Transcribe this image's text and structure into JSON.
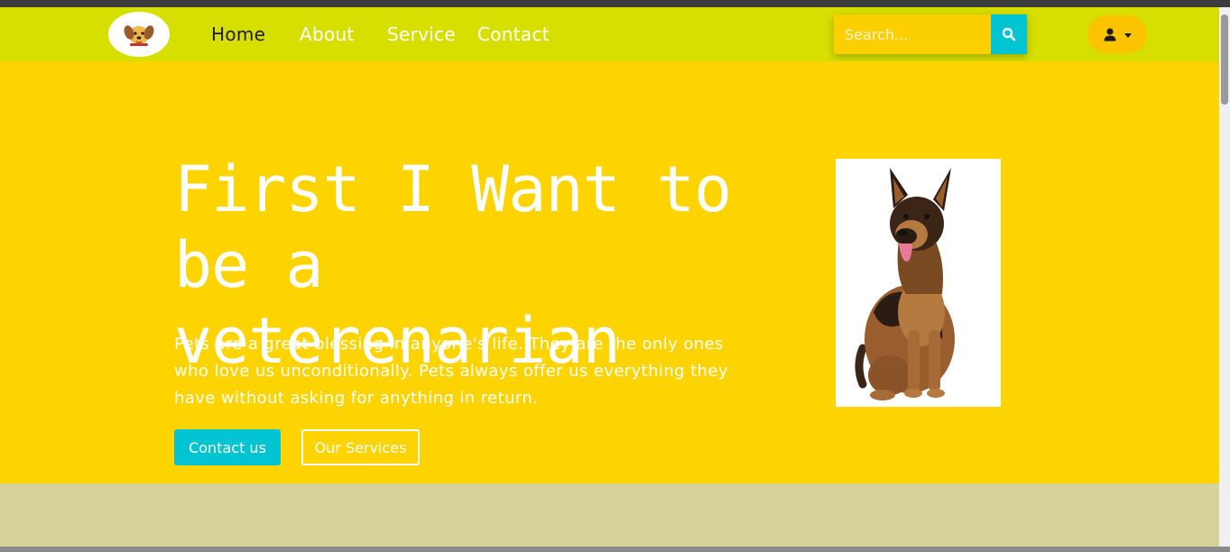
{
  "nav": {
    "links": [
      "Home",
      "About",
      "Service",
      "Contact"
    ],
    "active": "Home"
  },
  "search": {
    "placeholder": "Search..."
  },
  "hero": {
    "title_line1": "First I Want to",
    "title_line2": "be a veterenarian",
    "description": "Pets are a great blessing in anyone's life. They are the only ones who love us unconditionally. Pets always offer us everything they have without asking for anything in return.",
    "contact_button": "Contact us",
    "services_button": "Our Services"
  },
  "colors": {
    "navbar": "#d6df00",
    "hero": "#fdd300",
    "accent": "#00c4d1",
    "section_below": "#d6d29a"
  },
  "icons": [
    "dog-logo-icon",
    "search-icon",
    "user-icon",
    "chevron-down-icon"
  ]
}
